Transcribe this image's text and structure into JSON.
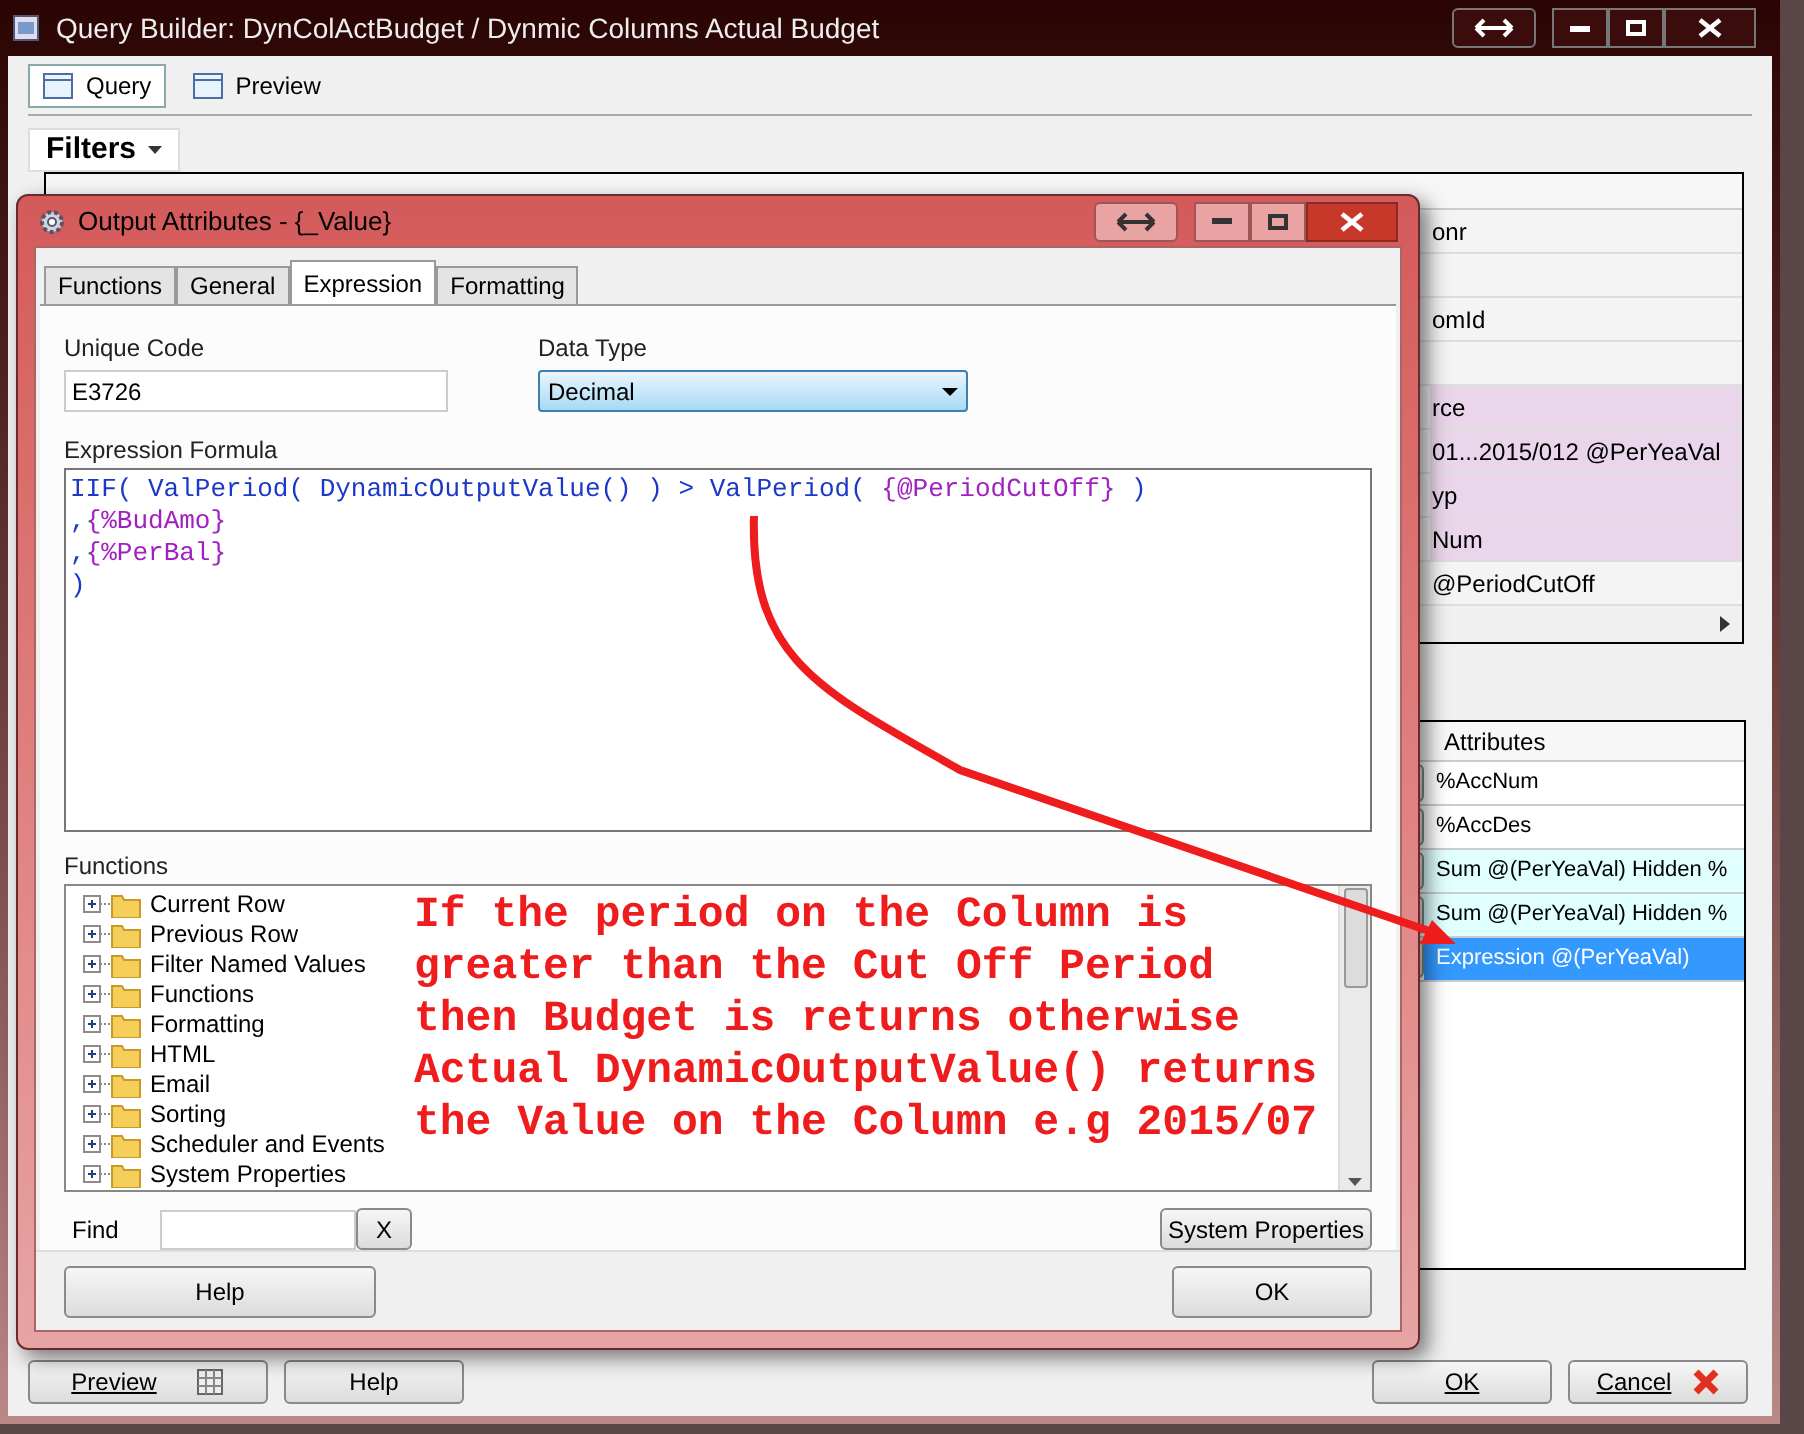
{
  "window": {
    "title": "Query Builder:  DynColActBudget / Dynmic Columns Actual Budget"
  },
  "tabs": [
    {
      "label": "Query",
      "selected": true
    },
    {
      "label": "Preview",
      "selected": false
    }
  ],
  "filters": {
    "button": "Filters",
    "rows": [
      {
        "detail": "onr",
        "highlighted": false
      },
      {
        "detail": "",
        "highlighted": false
      },
      {
        "detail": "omId",
        "highlighted": false
      },
      {
        "detail": "",
        "highlighted": false
      },
      {
        "detail": "rce",
        "highlighted": true
      },
      {
        "detail": "01...2015/012 @PerYeaVal",
        "highlighted": true
      },
      {
        "detail": "yp",
        "highlighted": true
      },
      {
        "detail": "Num",
        "highlighted": true
      },
      {
        "detail": "@PeriodCutOff",
        "highlighted": false
      }
    ]
  },
  "attributes": {
    "header": "Attributes",
    "rows": [
      {
        "text": "%AccNum",
        "highlighted": false,
        "selected": false
      },
      {
        "text": "%AccDes",
        "highlighted": false,
        "selected": false
      },
      {
        "text": "Sum @(PerYeaVal) Hidden %",
        "highlighted": true,
        "selected": false
      },
      {
        "text": "Sum @(PerYeaVal) Hidden %",
        "highlighted": true,
        "selected": false
      },
      {
        "text": "Expression @(PerYeaVal)",
        "highlighted": false,
        "selected": true
      }
    ]
  },
  "buttons": {
    "preview": "Preview",
    "help": "Help",
    "ok": "OK",
    "cancel": "Cancel"
  },
  "dialog": {
    "title": "Output Attributes - {_Value}",
    "tabs": [
      {
        "label": "Functions",
        "selected": false
      },
      {
        "label": "General",
        "selected": false
      },
      {
        "label": "Expression",
        "selected": true
      },
      {
        "label": "Formatting",
        "selected": false
      }
    ],
    "unique_code": {
      "label": "Unique Code",
      "value": "E3726"
    },
    "data_type": {
      "label": "Data Type",
      "value": "Decimal"
    },
    "formula": {
      "label": "Expression Formula",
      "lines": [
        [
          {
            "text": "IIF( ValPeriod( DynamicOutputValue() ) > ValPeriod( ",
            "kind": "function"
          },
          {
            "text": "{@PeriodCutOff}",
            "kind": "field"
          },
          {
            "text": " )",
            "kind": "function"
          }
        ],
        [
          {
            "text": ",",
            "kind": "function"
          },
          {
            "text": "{%BudAmo}",
            "kind": "field"
          }
        ],
        [
          {
            "text": ",",
            "kind": "function"
          },
          {
            "text": "{%PerBal}",
            "kind": "field"
          }
        ],
        [
          {
            "text": ")",
            "kind": "function"
          }
        ]
      ]
    },
    "functions": {
      "label": "Functions",
      "items": [
        "Current Row",
        "Previous Row",
        "Filter Named Values",
        "Functions",
        "Formatting",
        "HTML",
        "Email",
        "Sorting",
        "Scheduler and Events",
        "System Properties"
      ]
    },
    "annotation": "If the period on the Column is greater than the Cut Off Period then Budget is returns otherwise Actual DynamicOutputValue() returns the Value on the Column e.g 2015/07",
    "find": {
      "label": "Find",
      "clear": "X"
    },
    "system_properties": "System Properties",
    "help": "Help",
    "ok": "OK"
  }
}
